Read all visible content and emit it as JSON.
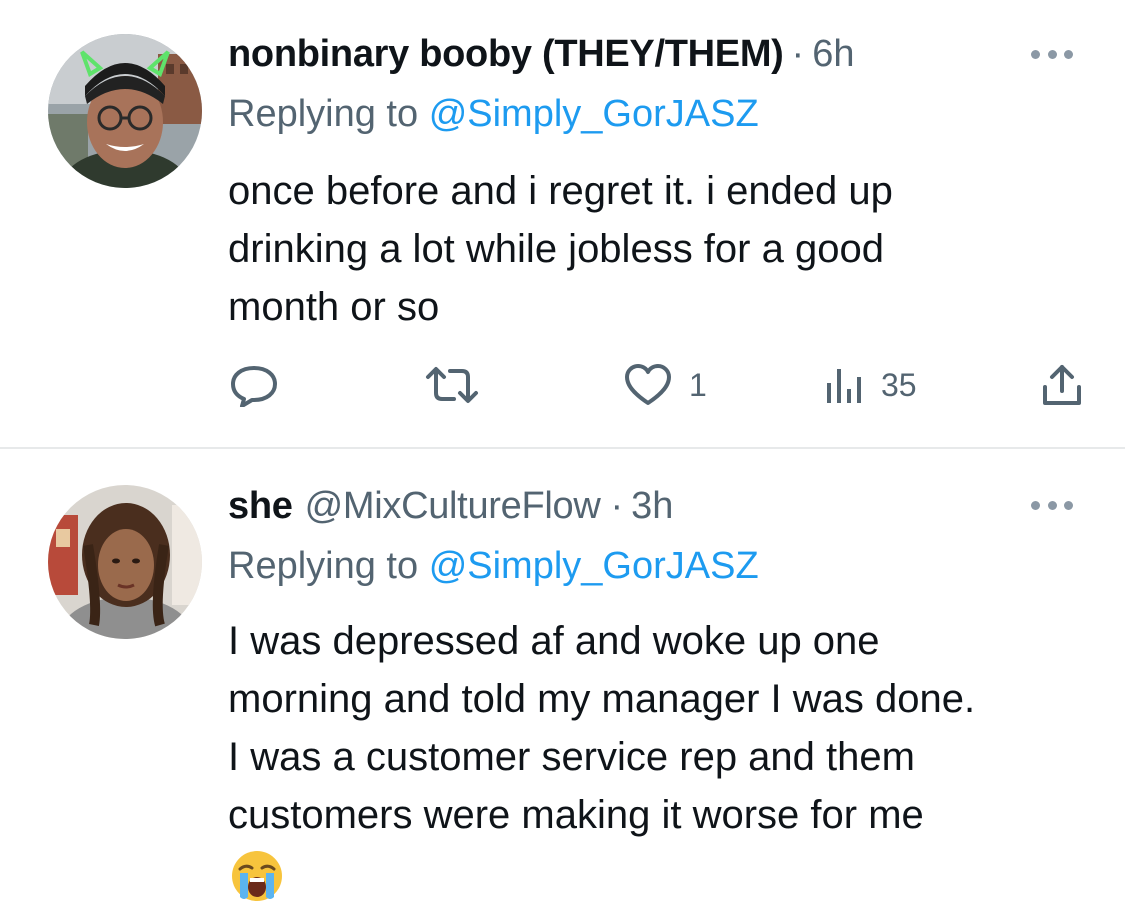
{
  "tweets": [
    {
      "display_name": "nonbinary booby (THEY/THEM)",
      "handle": "",
      "time": "6h",
      "replying_prefix": "Replying to",
      "replying_to": "@Simply_GorJASZ",
      "text": "once before and i regret it. i ended up\ndrinking a lot while jobless for a good\nmonth or so",
      "actions": {
        "reply_icon": "reply-icon",
        "retweet_icon": "retweet-icon",
        "like_icon": "heart-icon",
        "like_count": "1",
        "views_icon": "views-icon",
        "views_count": "35",
        "share_icon": "share-icon"
      }
    },
    {
      "display_name": "she",
      "handle": "@MixCultureFlow",
      "time": "3h",
      "replying_prefix": "Replying to",
      "replying_to": "@Simply_GorJASZ",
      "text": "I was depressed af and woke up one\nmorning and told my manager I was done.\nI was a customer service rep and them\ncustomers were making it worse for me",
      "emoji": "loudly-crying-face"
    }
  ],
  "separator": "·",
  "colors": {
    "primary_text": "#0f1419",
    "secondary_text": "#536471",
    "link": "#1d9bf0",
    "divider": "#e7e9ea"
  }
}
